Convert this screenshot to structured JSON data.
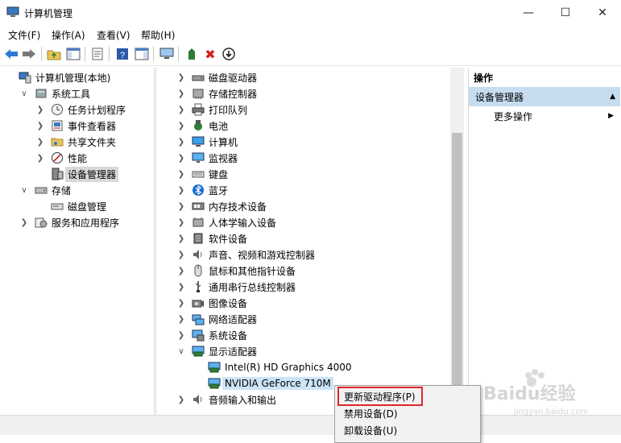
{
  "window": {
    "title": "计算机管理"
  },
  "menu": [
    "文件(F)",
    "操作(A)",
    "查看(V)",
    "帮助(H)"
  ],
  "left_tree": [
    {
      "label": "计算机管理(本地)",
      "indent": 0,
      "arrow": "",
      "icon": "computer-mgmt-icon"
    },
    {
      "label": "系统工具",
      "indent": 1,
      "arrow": "∨",
      "icon": "tools-icon"
    },
    {
      "label": "任务计划程序",
      "indent": 2,
      "arrow": ">",
      "icon": "clock-icon"
    },
    {
      "label": "事件查看器",
      "indent": 2,
      "arrow": ">",
      "icon": "event-viewer-icon"
    },
    {
      "label": "共享文件夹",
      "indent": 2,
      "arrow": ">",
      "icon": "shared-folder-icon"
    },
    {
      "label": "性能",
      "indent": 2,
      "arrow": ">",
      "icon": "performance-icon"
    },
    {
      "label": "设备管理器",
      "indent": 2,
      "arrow": "",
      "icon": "device-manager-icon",
      "selected": true
    },
    {
      "label": "存储",
      "indent": 1,
      "arrow": "∨",
      "icon": "storage-icon"
    },
    {
      "label": "磁盘管理",
      "indent": 2,
      "arrow": "",
      "icon": "disk-mgmt-icon"
    },
    {
      "label": "服务和应用程序",
      "indent": 1,
      "arrow": ">",
      "icon": "services-icon"
    }
  ],
  "device_tree": [
    {
      "label": "磁盘驱动器",
      "arrow": ">",
      "indent": 0,
      "icon": "disk-drive-icon"
    },
    {
      "label": "存储控制器",
      "arrow": ">",
      "indent": 0,
      "icon": "storage-controller-icon"
    },
    {
      "label": "打印队列",
      "arrow": ">",
      "indent": 0,
      "icon": "printer-icon"
    },
    {
      "label": "电池",
      "arrow": ">",
      "indent": 0,
      "icon": "battery-icon"
    },
    {
      "label": "计算机",
      "arrow": ">",
      "indent": 0,
      "icon": "computer-icon"
    },
    {
      "label": "监视器",
      "arrow": ">",
      "indent": 0,
      "icon": "monitor-icon"
    },
    {
      "label": "键盘",
      "arrow": ">",
      "indent": 0,
      "icon": "keyboard-icon"
    },
    {
      "label": "蓝牙",
      "arrow": ">",
      "indent": 0,
      "icon": "bluetooth-icon"
    },
    {
      "label": "内存技术设备",
      "arrow": ">",
      "indent": 0,
      "icon": "memory-icon"
    },
    {
      "label": "人体学输入设备",
      "arrow": ">",
      "indent": 0,
      "icon": "hid-icon"
    },
    {
      "label": "软件设备",
      "arrow": ">",
      "indent": 0,
      "icon": "software-device-icon"
    },
    {
      "label": "声音、视频和游戏控制器",
      "arrow": ">",
      "indent": 0,
      "icon": "speaker-icon"
    },
    {
      "label": "鼠标和其他指针设备",
      "arrow": ">",
      "indent": 0,
      "icon": "mouse-icon"
    },
    {
      "label": "通用串行总线控制器",
      "arrow": ">",
      "indent": 0,
      "icon": "usb-icon"
    },
    {
      "label": "图像设备",
      "arrow": ">",
      "indent": 0,
      "icon": "camera-icon"
    },
    {
      "label": "网络适配器",
      "arrow": ">",
      "indent": 0,
      "icon": "network-icon"
    },
    {
      "label": "系统设备",
      "arrow": ">",
      "indent": 0,
      "icon": "system-device-icon"
    },
    {
      "label": "显示适配器",
      "arrow": "∨",
      "indent": 0,
      "icon": "display-adapter-icon"
    },
    {
      "label": "Intel(R) HD Graphics 4000",
      "arrow": "",
      "indent": 1,
      "icon": "display-adapter-icon"
    },
    {
      "label": "NVIDIA GeForce 710M",
      "arrow": "",
      "indent": 1,
      "icon": "display-adapter-icon",
      "selected": true
    },
    {
      "label": "音频输入和输出",
      "arrow": ">",
      "indent": 0,
      "icon": "speaker-icon"
    }
  ],
  "actions": {
    "header": "操作",
    "section": "设备管理器",
    "more": "更多操作"
  },
  "context_menu": [
    "更新驱动程序(P)",
    "禁用设备(D)",
    "卸载设备(U)"
  ],
  "watermark": {
    "text": "Baidu经验",
    "sub": "jingyan.baidu.com"
  },
  "colors": {
    "selection": "#cce4f7",
    "highlight_box": "#e0262b",
    "actions_section": "#c6ddf0"
  }
}
